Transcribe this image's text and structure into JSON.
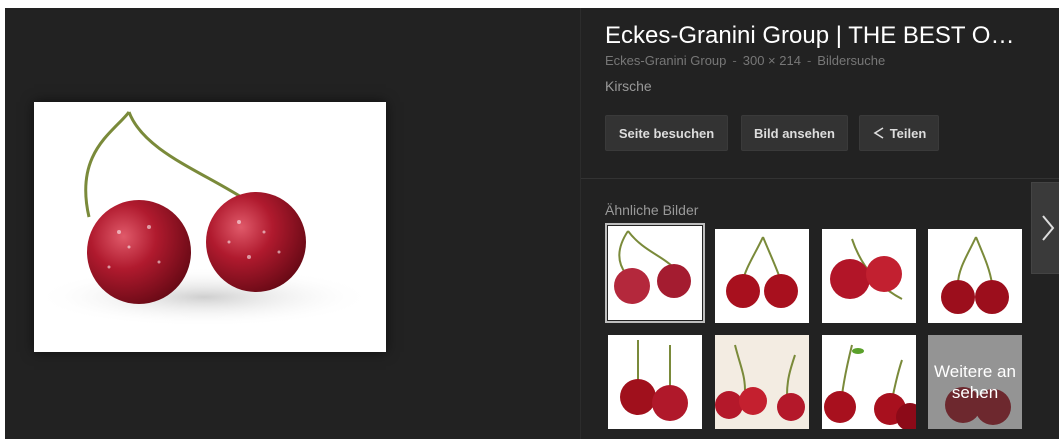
{
  "result": {
    "title": "Eckes-Granini Group | THE BEST O…",
    "source": "Eckes-Granini Group",
    "dimensions": "300 × 214",
    "search_type": "Bildersuche",
    "caption": "Kirsche"
  },
  "actions": {
    "visit_label": "Seite besuchen",
    "view_label": "Bild ansehen",
    "share_label": "Teilen"
  },
  "similar": {
    "heading": "Ähnliche Bilder",
    "more_label": "Weitere ansehen"
  },
  "icons": {
    "share": "share-icon",
    "next": "chevron-right-icon"
  },
  "colors": {
    "background": "#222222",
    "cherry": "#b01a2e",
    "stem": "#7a8a3a"
  }
}
